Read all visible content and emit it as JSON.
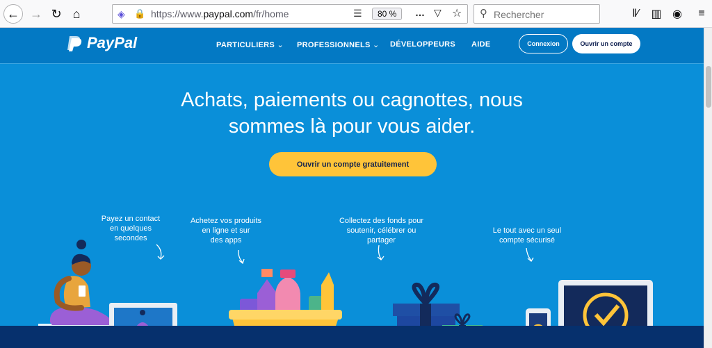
{
  "browser": {
    "url_prefix": "https://www.",
    "url_domain": "paypal.com",
    "url_path": "/fr/home",
    "zoom": "80 %",
    "search_placeholder": "Rechercher",
    "icons": [
      "back-icon",
      "forward-icon",
      "reload-icon",
      "home-icon",
      "shield-icon",
      "lock-icon",
      "reader-icon",
      "more-icon",
      "pocket-icon",
      "star-icon",
      "search-icon",
      "library-icon",
      "sidebar-icon",
      "account-icon",
      "menu-icon"
    ]
  },
  "header": {
    "brand": "PayPal",
    "nav": [
      "PARTICULIERS",
      "PROFESSIONNELS",
      "DÉVELOPPEURS",
      "AIDE"
    ],
    "login": "Connexion",
    "signup": "Ouvrir un compte"
  },
  "hero": {
    "title_line1": "Achats, paiements ou cagnottes, nous",
    "title_line2": "sommes là pour vous aider.",
    "cta": "Ouvrir un compte gratuitement"
  },
  "features": [
    {
      "line1": "Payez un contact",
      "line2": "en quelques",
      "line3": "secondes"
    },
    {
      "line1": "Achetez vos produits",
      "line2": "en ligne et sur",
      "line3": "des apps"
    },
    {
      "line1": "Collectez des fonds pour",
      "line2": "soutenir, célébrer ou",
      "line3": "partager"
    },
    {
      "line1": "Le tout avec un seul",
      "line2": "compte sécurisé",
      "line3": ""
    }
  ],
  "colors": {
    "hero_bg": "#0a8fd9",
    "header_bg": "#0379c4",
    "cta_yellow": "#ffc439",
    "footer_strip": "#06306d"
  }
}
